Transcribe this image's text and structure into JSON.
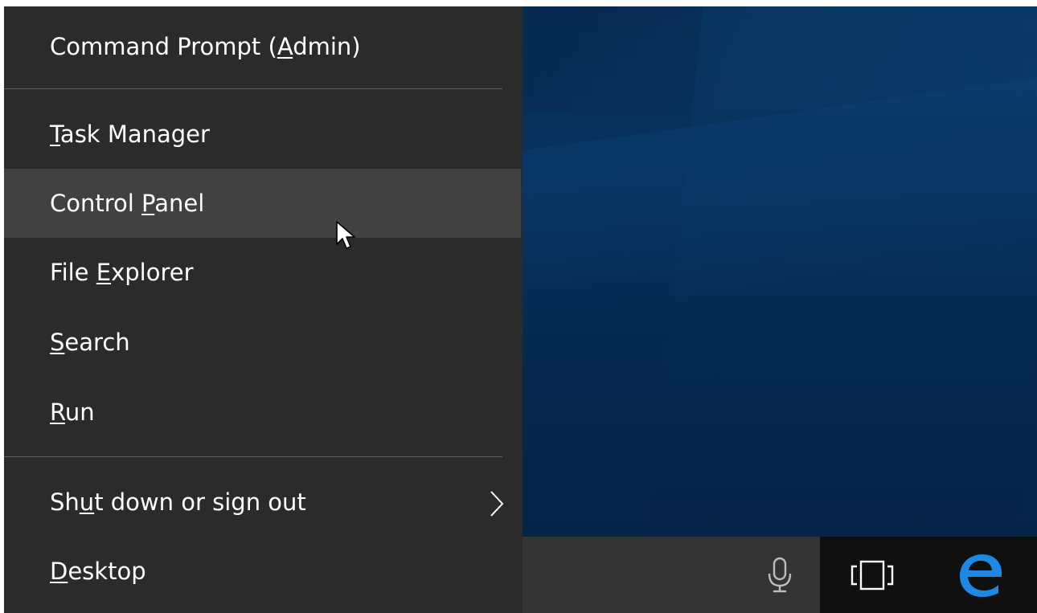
{
  "menu": {
    "items": [
      {
        "id": "command-prompt-admin",
        "before": "Command Prompt (",
        "accel": "A",
        "after": "dmin)"
      },
      {
        "id": "task-manager",
        "before": "",
        "accel": "T",
        "after": "ask Manager"
      },
      {
        "id": "control-panel",
        "before": "Control ",
        "accel": "P",
        "after": "anel",
        "state": "hover"
      },
      {
        "id": "file-explorer",
        "before": "File ",
        "accel": "E",
        "after": "xplorer"
      },
      {
        "id": "search",
        "before": "",
        "accel": "S",
        "after": "earch"
      },
      {
        "id": "run",
        "before": "",
        "accel": "R",
        "after": "un"
      },
      {
        "id": "shut-down",
        "before": "Sh",
        "accel": "u",
        "after": "t down or sign out",
        "submenu": true
      },
      {
        "id": "desktop",
        "before": "",
        "accel": "D",
        "after": "esktop"
      }
    ],
    "submenu_icon": "chevron-right-icon"
  },
  "taskbar": {
    "icons": [
      "microphone-icon",
      "task-view-icon",
      "edge-icon"
    ]
  },
  "colors": {
    "menu_bg": "#2b2b2b",
    "menu_hover": "#414141",
    "separator": "#5f5f5f",
    "text": "#ffffff",
    "desktop_bg": "#062a4e",
    "taskbar_bg": "#343434",
    "edge_blue": "#1e88e5"
  }
}
